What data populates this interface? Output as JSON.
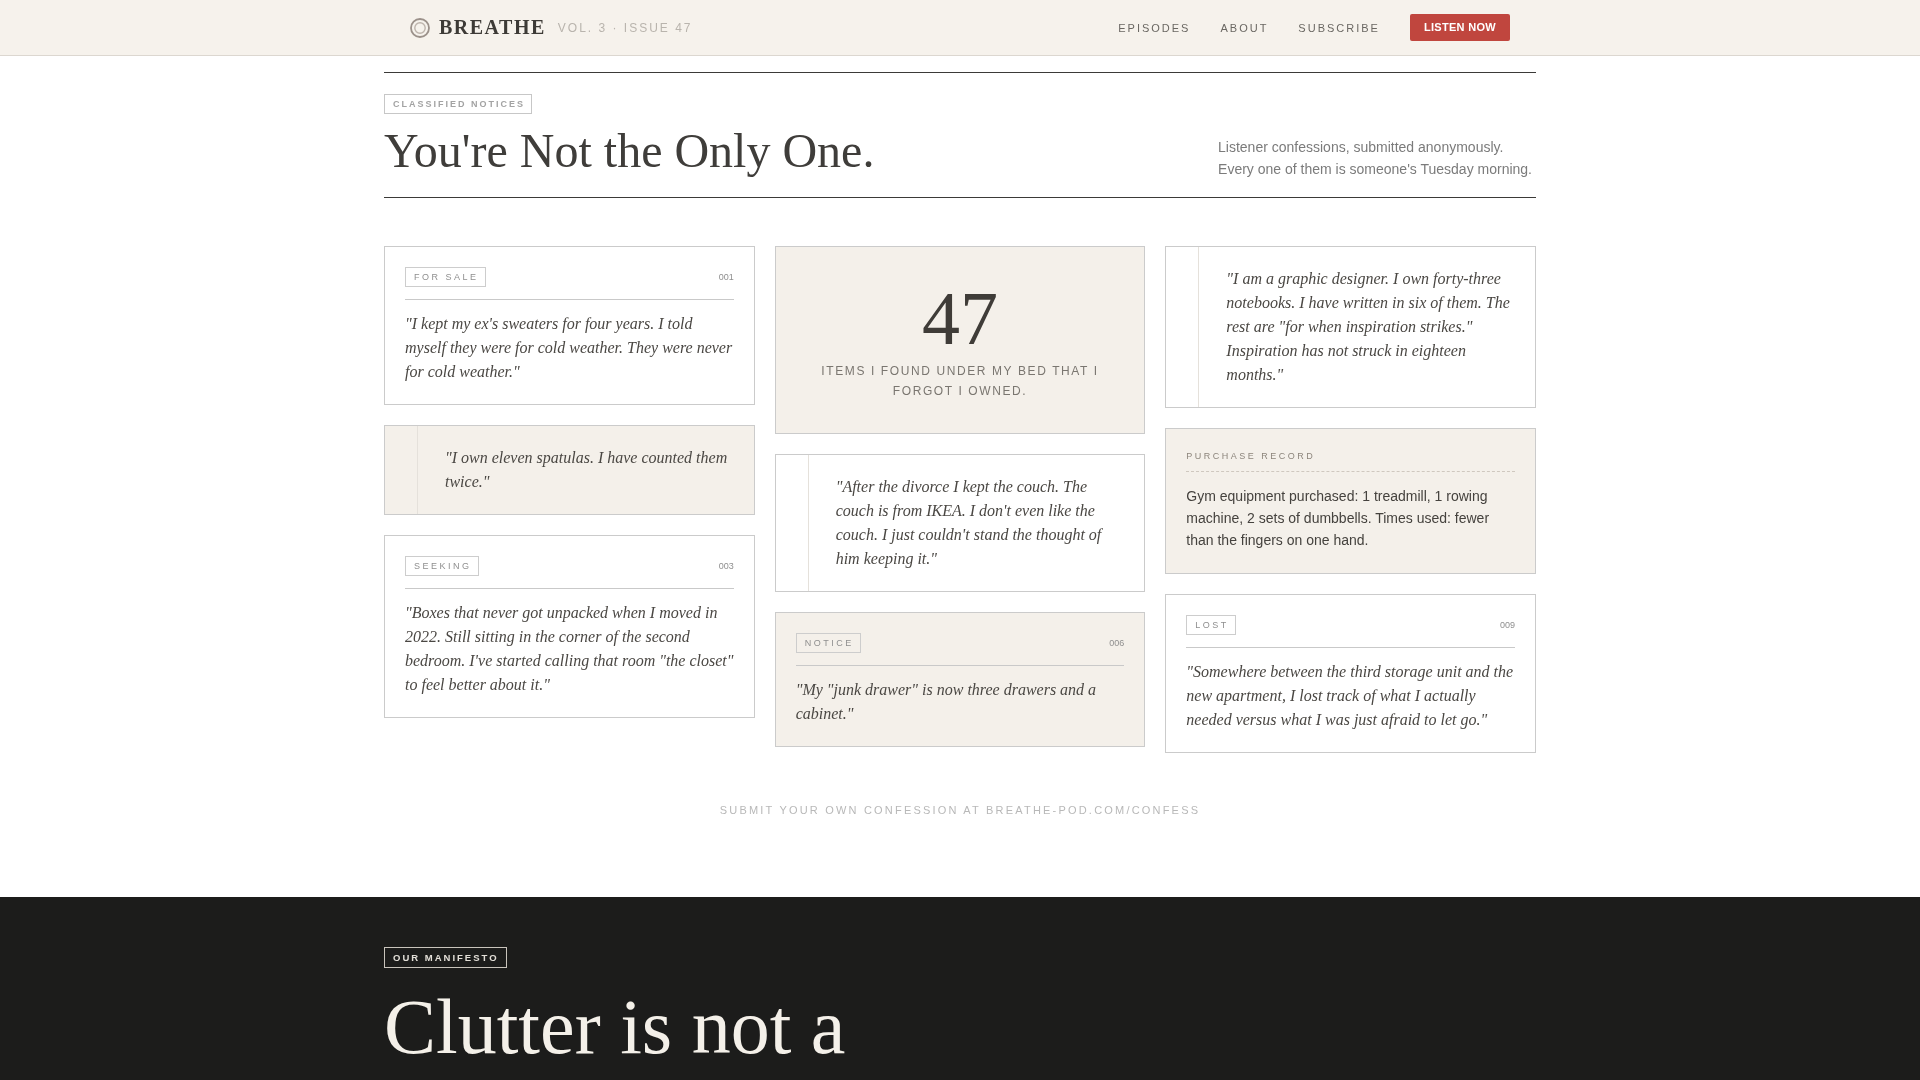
{
  "header": {
    "brand": "BREATHE",
    "issue": "VOL. 3 · ISSUE 47",
    "nav": [
      "EPISODES",
      "ABOUT",
      "SUBSCRIBE"
    ],
    "cta": "LISTEN NOW"
  },
  "intro": {
    "tag": "CLASSIFIED NOTICES",
    "title": "You're Not the Only One.",
    "description": [
      "Listener confessions, submitted anonymously.",
      "Every one of them is someone's Tuesday morning."
    ]
  },
  "columns": [
    {
      "cards": [
        {
          "kind": "listing",
          "shaded": false,
          "tag": "FOR SALE",
          "number": "001",
          "text": "\"I kept my ex's sweaters for four years. I told myself they were for cold weather. They were never for cold weather.\""
        },
        {
          "kind": "quote",
          "shaded": true,
          "text": "\"I own eleven spatulas. I have counted them twice.\""
        },
        {
          "kind": "listing",
          "shaded": false,
          "tag": "SEEKING",
          "number": "003",
          "text": "\"Boxes that never got unpacked when I moved in 2022. Still sitting in the corner of the second bedroom. I've started calling that room \"the closet\" to feel better about it.\""
        }
      ]
    },
    {
      "cards": [
        {
          "kind": "stat",
          "shaded": true,
          "value": "47",
          "caption": "ITEMS I FOUND UNDER MY BED THAT I FORGOT I OWNED."
        },
        {
          "kind": "quote",
          "shaded": false,
          "text": "\"After the divorce I kept the couch. The couch is from IKEA. I don't even like the couch. I just couldn't stand the thought of him keeping it.\""
        },
        {
          "kind": "listing",
          "shaded": true,
          "tag": "NOTICE",
          "number": "006",
          "text": "\"My \"junk drawer\" is now three drawers and a cabinet.\""
        }
      ]
    },
    {
      "cards": [
        {
          "kind": "quote",
          "shaded": false,
          "text": "\"I am a graphic designer. I own forty-three notebooks. I have written in six of them. The rest are \"for when inspiration strikes.\" Inspiration has not struck in eighteen months.\""
        },
        {
          "kind": "record",
          "shaded": true,
          "label": "PURCHASE RECORD",
          "text": "Gym equipment purchased: 1 treadmill, 1 rowing machine, 2 sets of dumbbells. Times used: fewer than the fingers on one hand."
        },
        {
          "kind": "listing",
          "shaded": false,
          "tag": "LOST",
          "number": "009",
          "text": "\"Somewhere between the third storage unit and the new apartment, I lost track of what I actually needed versus what I was just afraid to let go.\""
        }
      ]
    }
  ],
  "footer_note": "SUBMIT YOUR OWN CONFESSION AT BREATHE-POD.COM/CONFESS",
  "manifesto": {
    "tag": "OUR MANIFESTO",
    "title": "Clutter is not a"
  }
}
